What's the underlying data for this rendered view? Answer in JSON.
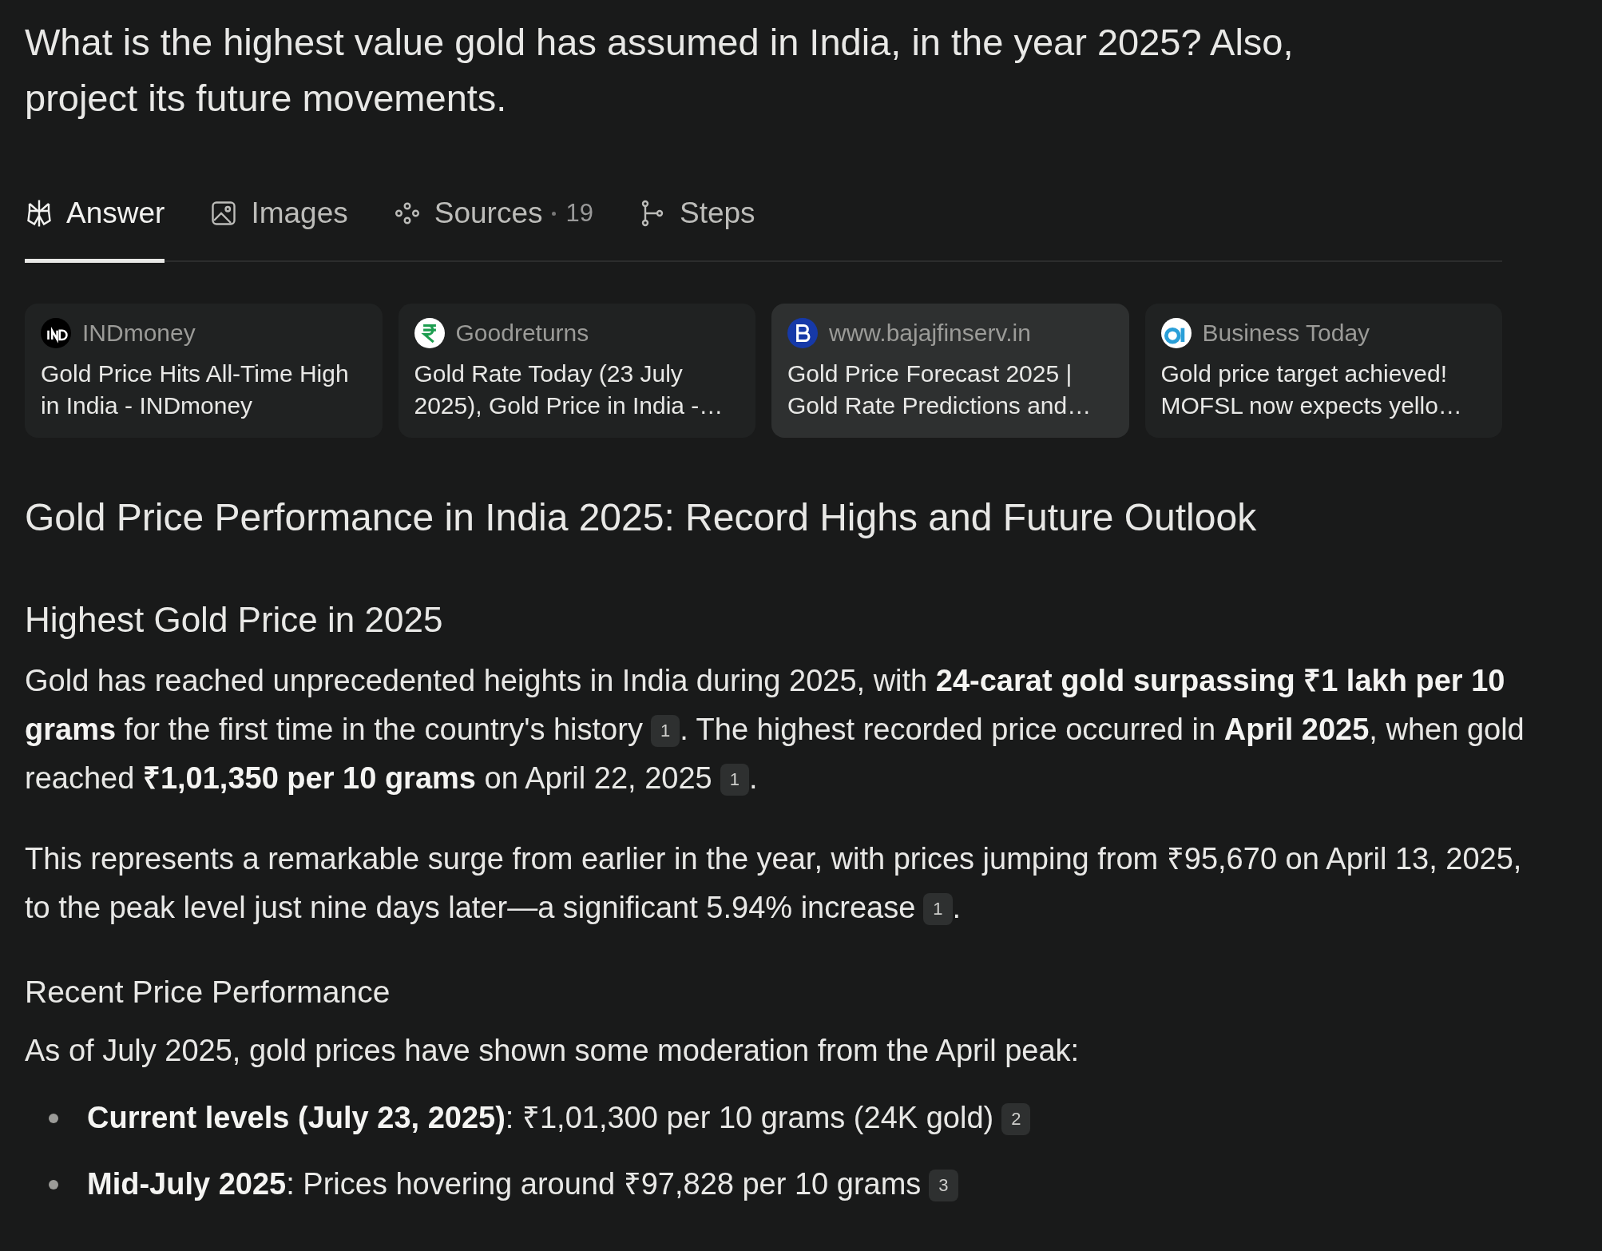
{
  "question": "What is the highest value gold has assumed in India, in the year 2025? Also, project its future movements.",
  "tabs": [
    {
      "label": "Answer",
      "selected": true
    },
    {
      "label": "Images",
      "selected": false
    },
    {
      "label": "Sources",
      "count": "19",
      "selected": false
    },
    {
      "label": "Steps",
      "selected": false
    }
  ],
  "sources": [
    {
      "site": "INDmoney",
      "title": "Gold Price Hits All-Time High in India - INDmoney",
      "highlighted": false
    },
    {
      "site": "Goodreturns",
      "title": "Gold Rate Today (23 July 2025), Gold Price in India -…",
      "highlighted": false
    },
    {
      "site": "www.bajajfinserv.in",
      "title": "Gold Price Forecast 2025 | Gold Rate Predictions and…",
      "highlighted": true
    },
    {
      "site": "Business Today",
      "title": "Gold price target achieved! MOFSL now expects yello…",
      "highlighted": false
    }
  ],
  "article": {
    "title": "Gold Price Performance in India 2025: Record Highs and Future Outlook",
    "sections": [
      {
        "heading": "Highest Gold Price in 2025",
        "kind": "section",
        "blocks": [
          {
            "kind": "paragraph",
            "parts": [
              {
                "kind": "text",
                "text": "Gold has reached unprecedented heights in India during 2025, with **24-carat gold surpassing ₹1 lakh per 10 grams** for the first time in the country's history"
              },
              {
                "kind": "cite",
                "text": "1"
              },
              {
                "kind": "text",
                "text": ". The highest recorded price occurred in **April 2025**, when gold reached **₹1,01,350 per 10 grams** on April 22, 2025"
              },
              {
                "kind": "cite",
                "text": "1"
              },
              {
                "kind": "text",
                "text": "."
              }
            ]
          },
          {
            "kind": "paragraph",
            "parts": [
              {
                "kind": "text",
                "text": "This represents a remarkable surge from earlier in the year, with prices jumping from ₹95,670 on April 13, 2025, to the peak level just nine days later—a significant 5.94% increase"
              },
              {
                "kind": "cite",
                "text": "1"
              },
              {
                "kind": "text",
                "text": "."
              }
            ]
          }
        ]
      },
      {
        "heading": "Recent Price Performance",
        "kind": "subsection",
        "blocks": [
          {
            "kind": "paragraph",
            "parts": [
              {
                "kind": "text",
                "text": "As of July 2025, gold prices have shown some moderation from the April peak:"
              }
            ]
          },
          {
            "kind": "list",
            "items": [
              {
                "parts": [
                  {
                    "kind": "text",
                    "text": "**Current levels (July 23, 2025)**: ₹1,01,300 per 10 grams (24K gold)"
                  },
                  {
                    "kind": "cite",
                    "text": "2"
                  }
                ]
              },
              {
                "parts": [
                  {
                    "kind": "text",
                    "text": "**Mid-July 2025**: Prices hovering around ₹97,828 per 10 grams"
                  },
                  {
                    "kind": "cite",
                    "text": "3"
                  }
                ]
              }
            ]
          }
        ]
      }
    ]
  }
}
